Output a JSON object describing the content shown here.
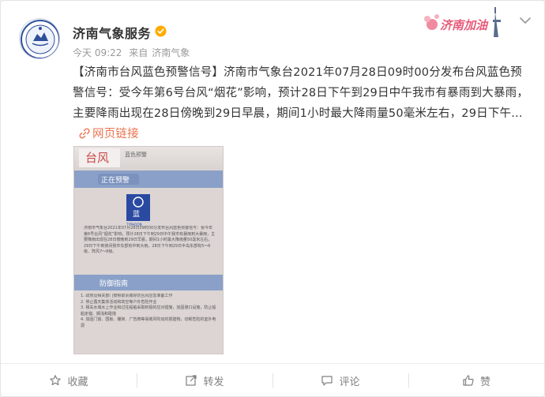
{
  "account": {
    "name": "济南气象服务"
  },
  "meta": {
    "time": "今天 09:22",
    "from": "来自",
    "source": "济南气象"
  },
  "promo": {
    "text": "济南加油"
  },
  "post": {
    "text": "【济南市台风蓝色预警信号】济南市气象台2021年07月28日09时00分发布台风蓝色预警信号：受今年第6号台风“烟花”影响，预计28日下午到29日中午我市有暴雨到大暴雨，主要降雨出现在28日傍晚到29日早晨，期间1小时最大降雨量50毫米左右，29日下午...",
    "link_label": "网页链接"
  },
  "poster": {
    "title": "台风",
    "subtitle": "蓝色预警",
    "status": "正在预警",
    "badge": "蓝",
    "badge_sub": "TYPHOON",
    "body": "济南市气象台2021年07月28日09时00分发布台风蓝色预警信号：受今年第6号台风“烟花”影响，预计28日下午到29日中午我市有暴雨到大暴雨，主要降雨出现在28日傍晚到29日早晨，期间1小时最大降雨量50毫米左右，29日下午到夜间我市东部有中到大雨，28日下午到29日半岛东部有5～6级、阵风7～8级。",
    "guide_title": "防御指南",
    "guide": [
      "1. 政府及相关部门按照职责做好防台风应急准备工作",
      "2. 停止露天集体活动和高空等户外危险作业",
      "3. 相关水域水上作业和过往船舶采取积极的应对措施，加固港口设施，防止船舶走锚、搁浅和碰撞",
      "4. 加固门窗、围板、棚架、广告牌等易被风吹动的搭建物，切断危险的室外电源"
    ]
  },
  "actions": {
    "favorite": "收藏",
    "repost": "转发",
    "comment": "评论",
    "like": "赞"
  },
  "colors": {
    "link": "#eb7350",
    "verify": "#ffab00",
    "poster_header": "#8aa0c8",
    "poster_badge": "#2a4aa2"
  }
}
